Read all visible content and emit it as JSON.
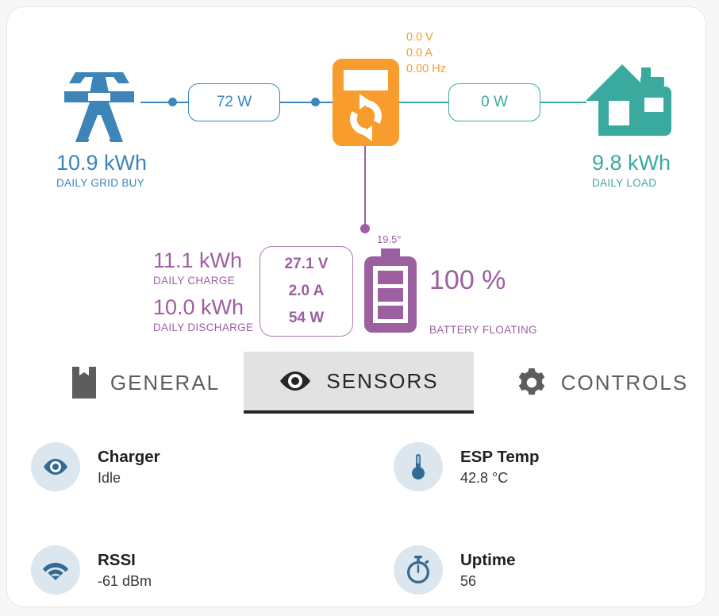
{
  "diagram": {
    "grid": {
      "icon": "transmission-tower-icon",
      "energy": "10.9 kWh",
      "label": "DAILY GRID BUY",
      "power": "72 W",
      "color": "#3d85b8"
    },
    "inverter": {
      "icon": "inverter-icon",
      "voltage": "0.0 V",
      "current": "0.0 A",
      "frequency": "0.00 Hz",
      "color": "#f79c2d"
    },
    "load": {
      "icon": "house-load-icon",
      "energy": "9.8 kWh",
      "label": "DAILY LOAD",
      "power": "0 W",
      "color": "#3aaa9e"
    },
    "battery": {
      "icon": "battery-icon",
      "daily_charge_value": "11.1 kWh",
      "daily_charge_label": "DAILY CHARGE",
      "daily_discharge_value": "10.0 kWh",
      "daily_discharge_label": "DAILY DISCHARGE",
      "voltage": "27.1 V",
      "current": "2.0 A",
      "power": "54 W",
      "temperature": "19.5°",
      "soc": "100 %",
      "state": "BATTERY FLOATING",
      "color": "#9c5fa0"
    }
  },
  "tabs": [
    {
      "label": "GENERAL",
      "icon": "book-icon",
      "active": false
    },
    {
      "label": "SENSORS",
      "icon": "eye-icon",
      "active": true
    },
    {
      "label": "CONTROLS",
      "icon": "gear-icon",
      "active": false
    }
  ],
  "sensors": [
    {
      "name": "Charger",
      "value": "Idle",
      "icon": "eye-icon"
    },
    {
      "name": "ESP Temp",
      "value": "42.8 °C",
      "icon": "thermometer-icon"
    },
    {
      "name": "RSSI",
      "value": "-61 dBm",
      "icon": "wifi-icon"
    },
    {
      "name": "Uptime",
      "value": "56",
      "icon": "stopwatch-icon"
    }
  ]
}
